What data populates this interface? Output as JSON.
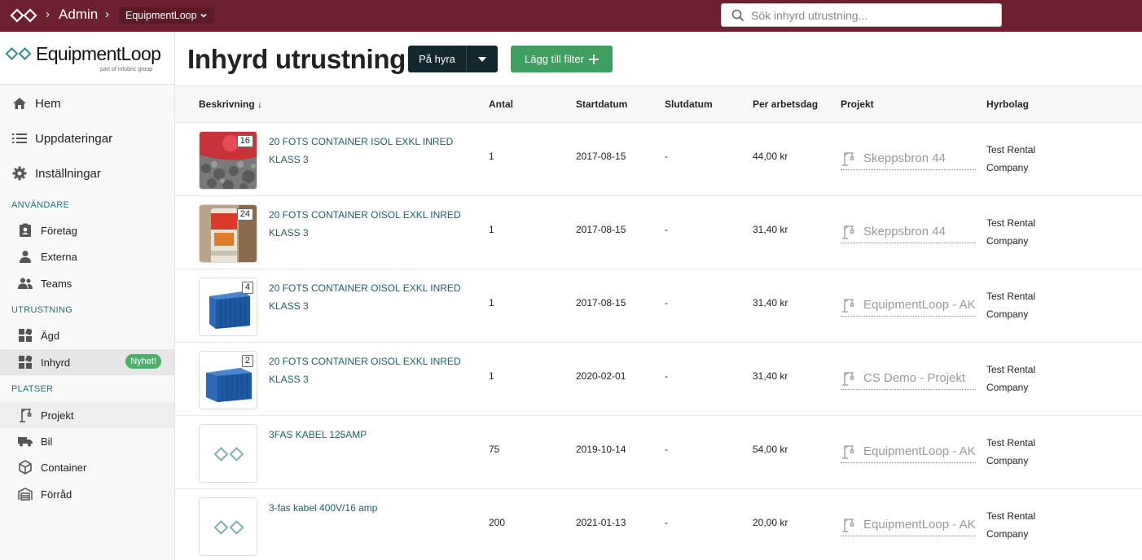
{
  "topbar": {
    "breadcrumb_admin": "Admin",
    "org_selector": "EquipmentLoop",
    "search_placeholder": "Sök inhyrd utrustning..."
  },
  "brand": {
    "name": "EquipmentLoop",
    "sub": "part of infobric group"
  },
  "sidebar": {
    "main": [
      {
        "label": "Hem",
        "icon": "home-icon"
      },
      {
        "label": "Uppdateringar",
        "icon": "list-icon"
      },
      {
        "label": "Inställningar",
        "icon": "gear-icon"
      }
    ],
    "sections": {
      "users": "ANVÄNDARE",
      "equipment": "UTRUSTNING",
      "places": "PLATSER"
    },
    "users_items": [
      {
        "label": "Företag",
        "icon": "company-badge-icon"
      },
      {
        "label": "Externa",
        "icon": "person-icon"
      },
      {
        "label": "Teams",
        "icon": "people-icon"
      }
    ],
    "equipment_items": [
      {
        "label": "Ägd",
        "icon": "grid-icon"
      },
      {
        "label": "Inhyrd",
        "icon": "grid-icon",
        "badge": "Nyhet!"
      }
    ],
    "places_items": [
      {
        "label": "Projekt",
        "icon": "crane-icon"
      },
      {
        "label": "Bil",
        "icon": "truck-icon"
      },
      {
        "label": "Container",
        "icon": "box-icon"
      },
      {
        "label": "Förråd",
        "icon": "warehouse-icon"
      }
    ]
  },
  "header": {
    "title": "Inhyrd utrustning",
    "status_button": "På hyra",
    "filter_button": "Lägg till filter"
  },
  "table": {
    "columns": {
      "description": "Beskrivning ↓",
      "quantity": "Antal",
      "start": "Startdatum",
      "end": "Slutdatum",
      "per_day": "Per arbetsdag",
      "project": "Projekt",
      "company": "Hyrbolag"
    },
    "rows": [
      {
        "count": "16",
        "thumb": "gravel",
        "description": "20 FOTS CONTAINER ISOL EXKL INRED KLASS 3",
        "quantity": "1",
        "start": "2017-08-15",
        "end": "-",
        "per_day": "44,00 kr",
        "project": "Skeppsbron 44",
        "company": "Test Rental Company"
      },
      {
        "count": "24",
        "thumb": "can",
        "description": "20 FOTS CONTAINER OISOL EXKL INRED KLASS 3",
        "quantity": "1",
        "start": "2017-08-15",
        "end": "-",
        "per_day": "31,40 kr",
        "project": "Skeppsbron 44",
        "company": "Test Rental Company"
      },
      {
        "count": "4",
        "thumb": "container",
        "description": "20 FOTS CONTAINER OISOL EXKL INRED KLASS 3",
        "quantity": "1",
        "start": "2017-08-15",
        "end": "-",
        "per_day": "31,40 kr",
        "project": "EquipmentLoop - AK",
        "company": "Test Rental Company"
      },
      {
        "count": "2",
        "thumb": "container2",
        "description": "20 FOTS CONTAINER OISOL EXKL INRED KLASS 3",
        "quantity": "1",
        "start": "2020-02-01",
        "end": "-",
        "per_day": "31,40 kr",
        "project": "CS Demo - Projekt",
        "company": "Test Rental Company"
      },
      {
        "count": "",
        "thumb": "placeholder",
        "description": "3FAS KABEL 125AMP",
        "quantity": "75",
        "start": "2019-10-14",
        "end": "-",
        "per_day": "54,00 kr",
        "project": "EquipmentLoop - AK",
        "company": "Test Rental Company"
      },
      {
        "count": "",
        "thumb": "placeholder",
        "description": "3-fas kabel 400V/16 amp",
        "quantity": "200",
        "start": "2021-01-13",
        "end": "-",
        "per_day": "20,00 kr",
        "project": "EquipmentLoop - AK",
        "company": "Test Rental Company"
      }
    ]
  },
  "colors": {
    "topbar": "#6e2030",
    "accent_link": "#1d5f6b",
    "green": "#3f9e60",
    "dark_button": "#13282e"
  }
}
